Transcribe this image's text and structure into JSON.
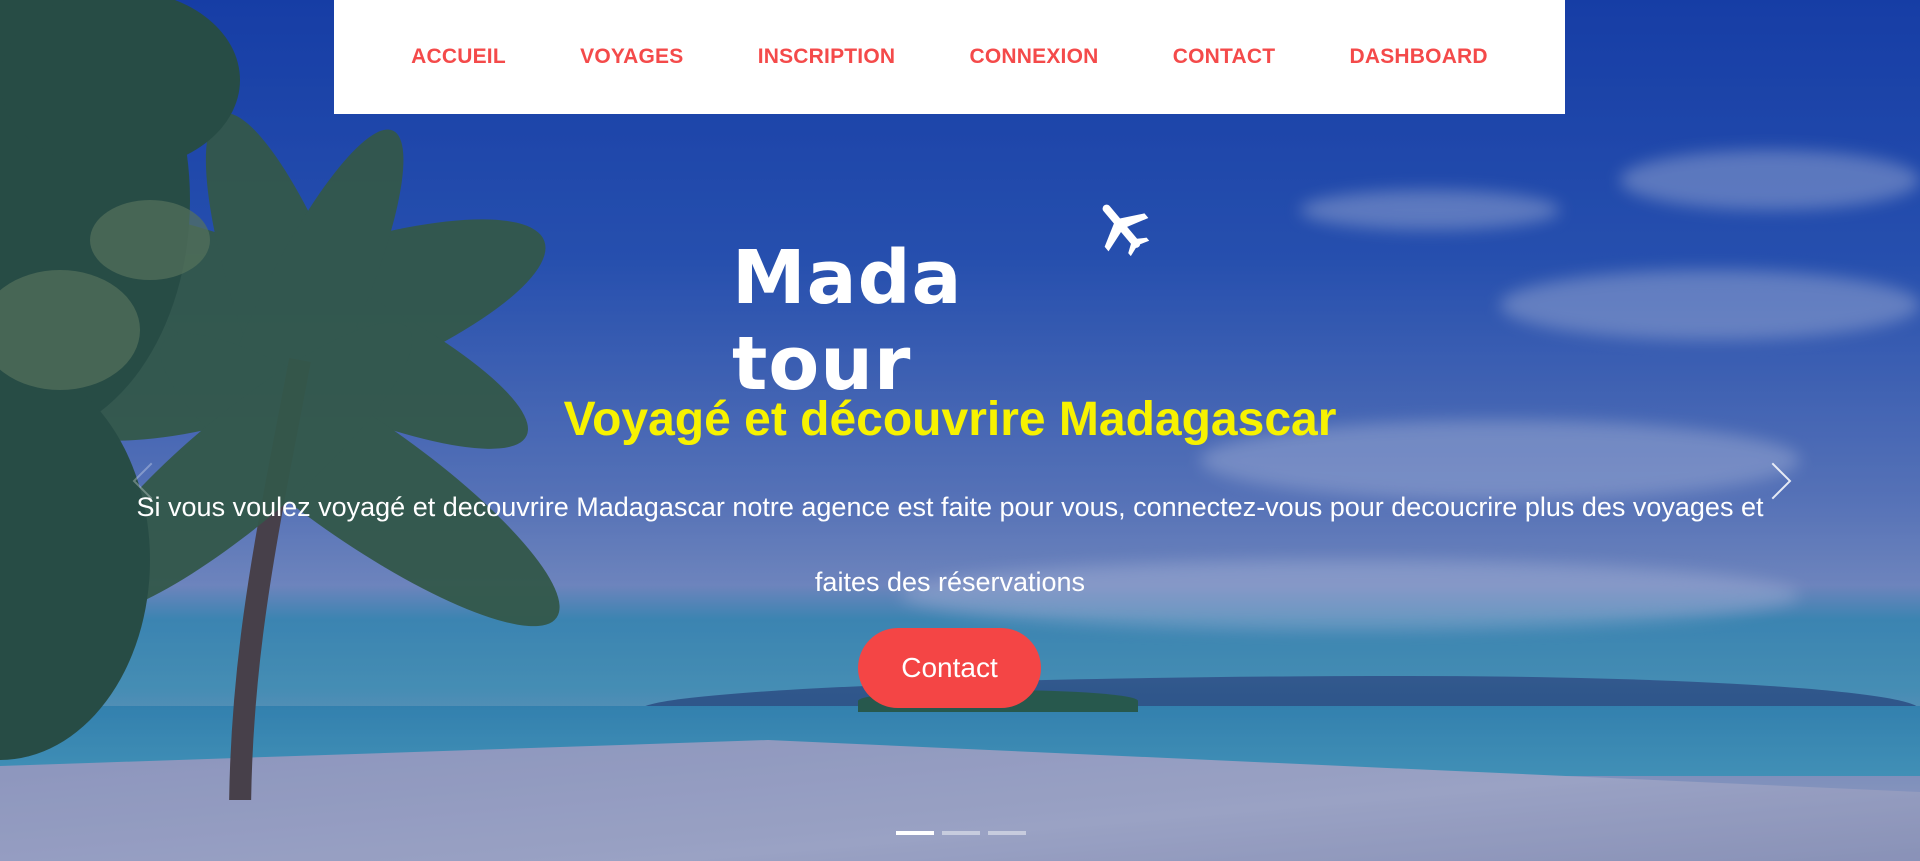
{
  "nav": {
    "items": [
      {
        "label": "ACCUEIL"
      },
      {
        "label": "VOYAGES"
      },
      {
        "label": "INSCRIPTION"
      },
      {
        "label": "CONNEXION"
      },
      {
        "label": "CONTACT"
      },
      {
        "label": "DASHBOARD"
      }
    ],
    "color": "#f44a4a"
  },
  "hero": {
    "logo_text": "Mada tour",
    "logo_icon": "airplane-icon",
    "headline": "Voyagé et découvrire Madagascar",
    "description": "Si vous voulez voyagé et decouvrire Madagascar notre agence est faite pour vous, connectez-vous pour decoucrire plus des voyages et faites des réservations",
    "button_label": "Contact",
    "colors": {
      "headline": "#f7f200",
      "button": "#f44545"
    }
  },
  "carousel": {
    "prev_icon": "chevron-left-icon",
    "next_icon": "chevron-right-icon",
    "slide_count": 3,
    "active_slide": 1
  }
}
